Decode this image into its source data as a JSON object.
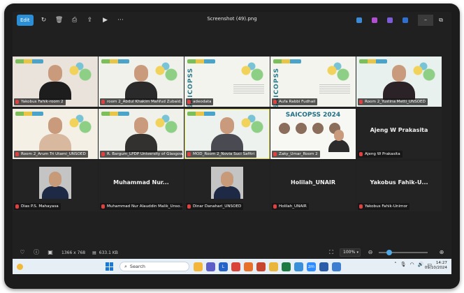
{
  "app": {
    "title": "Screenshot (49).png",
    "edit_label": "Edit",
    "toolbar_icons": [
      "rotate-icon",
      "delete-icon",
      "print-icon",
      "share-icon",
      "slideshow-icon",
      "more-icon"
    ],
    "more_label": "···",
    "window_controls": {
      "minimize": "–",
      "restore": "⧉"
    }
  },
  "gallery": {
    "tiles": [
      {
        "type": "video",
        "name": "Yakobus Fahik-room 2",
        "bg": "#e9e3db",
        "accent": "#1d1d1d"
      },
      {
        "type": "video",
        "name": "room 2_Abdul Khakim Mahfud Zubaid...",
        "bg": "#f1f1ec",
        "accent": "#2a2a2a"
      },
      {
        "type": "slide",
        "name": "adeodata"
      },
      {
        "type": "slide",
        "name": "Aufa Rabbi Fudhail"
      },
      {
        "type": "video",
        "name": "Room 2_Yustina Metti_UNSOED",
        "bg": "#e9f1ef",
        "accent": "#2a2226"
      },
      {
        "type": "video",
        "name": "Room 2_Arum Tri Utami_UNSOED",
        "bg": "#f4f0e6",
        "accent": "#d9b8a0"
      },
      {
        "type": "video",
        "name": "R. Bargum_LPDP University of Glasgow",
        "bg": "#f1f1ec",
        "accent": "#33312f"
      },
      {
        "type": "video",
        "name": "MOD_Room 2_Novia Suci Safitri",
        "bg": "#eef2ee",
        "accent": "#4a4a52",
        "speaking": true
      },
      {
        "type": "saic",
        "name": "Zaky_Umar_Room 2",
        "slide_title": "SAICOPSS 2024"
      },
      {
        "type": "name",
        "name": "Ajeng W Prakasita",
        "display": "Ajeng W Prakasita"
      },
      {
        "type": "picture",
        "name": "Dias P.S. Mahayasa"
      },
      {
        "type": "name",
        "name": "Muhammad Nur Alauddin Malik_Unso...",
        "display": "Muhammad  Nur..."
      },
      {
        "type": "picture",
        "name": "Dinar Danahari_UNSOED"
      },
      {
        "type": "name",
        "name": "Holilah_UNAIR",
        "display": "Holilah_UNAIR"
      },
      {
        "type": "name",
        "name": "Yakobus Fahik-Unimor",
        "display": "Yakobus Fahik-U..."
      }
    ],
    "slide_vertical_text": "SAICOPSS"
  },
  "statusbar": {
    "dimensions": "1366 x 768",
    "filesize": "633.1 KB",
    "zoom": "100%",
    "zoom_fraction": 0.18
  },
  "taskbar": {
    "search_placeholder": "Search",
    "app_icons": [
      {
        "name": "file-explorer-icon",
        "color": "#f3b63a",
        "label": ""
      },
      {
        "name": "teams-icon",
        "color": "#5b5fc7",
        "label": ""
      },
      {
        "name": "l-app-icon",
        "color": "#2463c7",
        "label": "L"
      },
      {
        "name": "chrome-icon",
        "color": "#d9433a",
        "label": ""
      },
      {
        "name": "firefox-icon",
        "color": "#e8712a",
        "label": ""
      },
      {
        "name": "powerpoint-icon",
        "color": "#c9442c",
        "label": ""
      },
      {
        "name": "explorer-folder-icon",
        "color": "#e9b53b",
        "label": ""
      },
      {
        "name": "excel-icon",
        "color": "#1d7a43",
        "label": ""
      },
      {
        "name": "photos-icon",
        "color": "#3a8fd9",
        "label": ""
      },
      {
        "name": "zoom-icon",
        "color": "#2d8cff",
        "label": "zm"
      },
      {
        "name": "word-icon",
        "color": "#2a5caa",
        "label": ""
      },
      {
        "name": "snip-icon",
        "color": "#3c7fd0",
        "label": ""
      }
    ],
    "time": "14:27",
    "date": "09/10/2024"
  }
}
